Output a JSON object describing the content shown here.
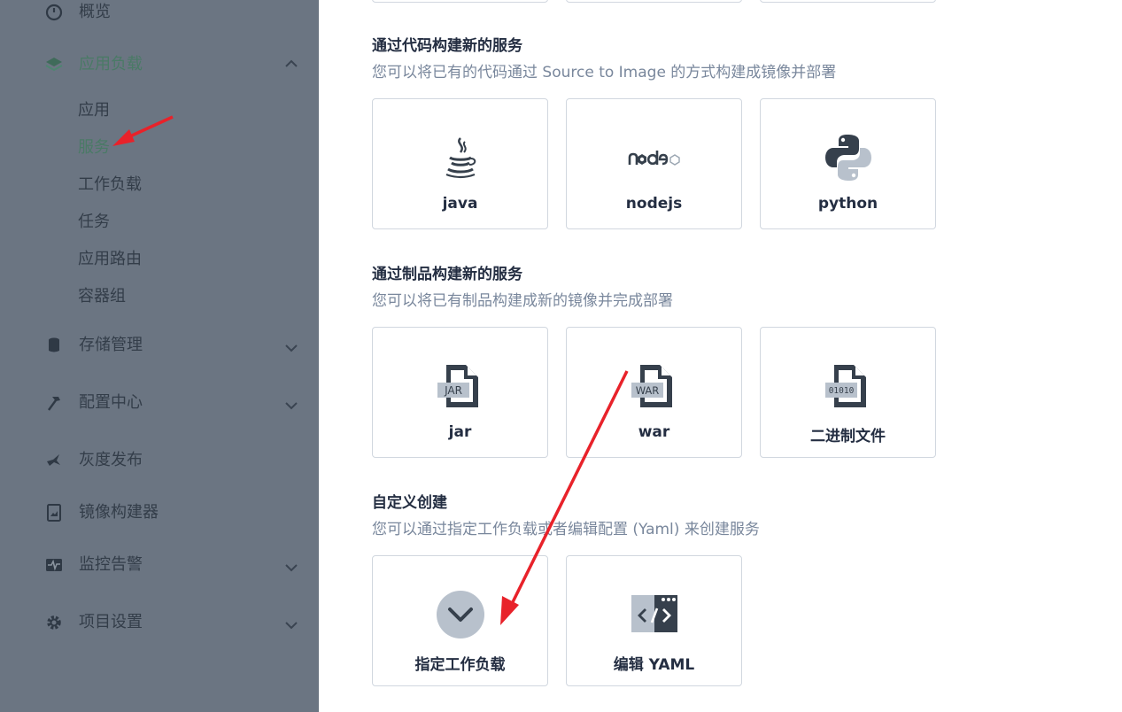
{
  "sidebar": {
    "items": [
      {
        "label": "概览",
        "icon": "dashboard-icon"
      },
      {
        "label": "应用负载",
        "icon": "layers-icon",
        "expanded": true
      },
      {
        "label": "存储管理",
        "icon": "storage-icon"
      },
      {
        "label": "配置中心",
        "icon": "hammer-icon"
      },
      {
        "label": "灰度发布",
        "icon": "bird-icon"
      },
      {
        "label": "镜像构建器",
        "icon": "image-builder-icon"
      },
      {
        "label": "监控告警",
        "icon": "monitor-icon"
      },
      {
        "label": "项目设置",
        "icon": "gear-icon"
      }
    ],
    "subitems": [
      "应用",
      "服务",
      "工作负载",
      "任务",
      "应用路由",
      "容器组"
    ],
    "active_subitem": "服务"
  },
  "sections": [
    {
      "title": "通过代码构建新的服务",
      "desc": "您可以将已有的代码通过 Source to Image 的方式构建成镜像并部署",
      "cards": [
        {
          "label": "java",
          "icon": "java-icon"
        },
        {
          "label": "nodejs",
          "icon": "nodejs-icon"
        },
        {
          "label": "python",
          "icon": "python-icon"
        }
      ]
    },
    {
      "title": "通过制品构建新的服务",
      "desc": "您可以将已有制品构建成新的镜像并完成部署",
      "cards": [
        {
          "label": "jar",
          "icon": "jar-file-icon",
          "badge": "JAR"
        },
        {
          "label": "war",
          "icon": "war-file-icon",
          "badge": "WAR"
        },
        {
          "label": "二进制文件",
          "icon": "binary-file-icon",
          "badge": "01010"
        }
      ]
    },
    {
      "title": "自定义创建",
      "desc": "您可以通过指定工作负载或者编辑配置 (Yaml) 来创建服务",
      "cards": [
        {
          "label": "指定工作负载",
          "icon": "chevron-down-circle-icon"
        },
        {
          "label": "编辑 YAML",
          "icon": "code-editor-icon"
        }
      ]
    }
  ],
  "colors": {
    "annotation_arrow": "#e8222a",
    "active": "#4a7a66"
  }
}
